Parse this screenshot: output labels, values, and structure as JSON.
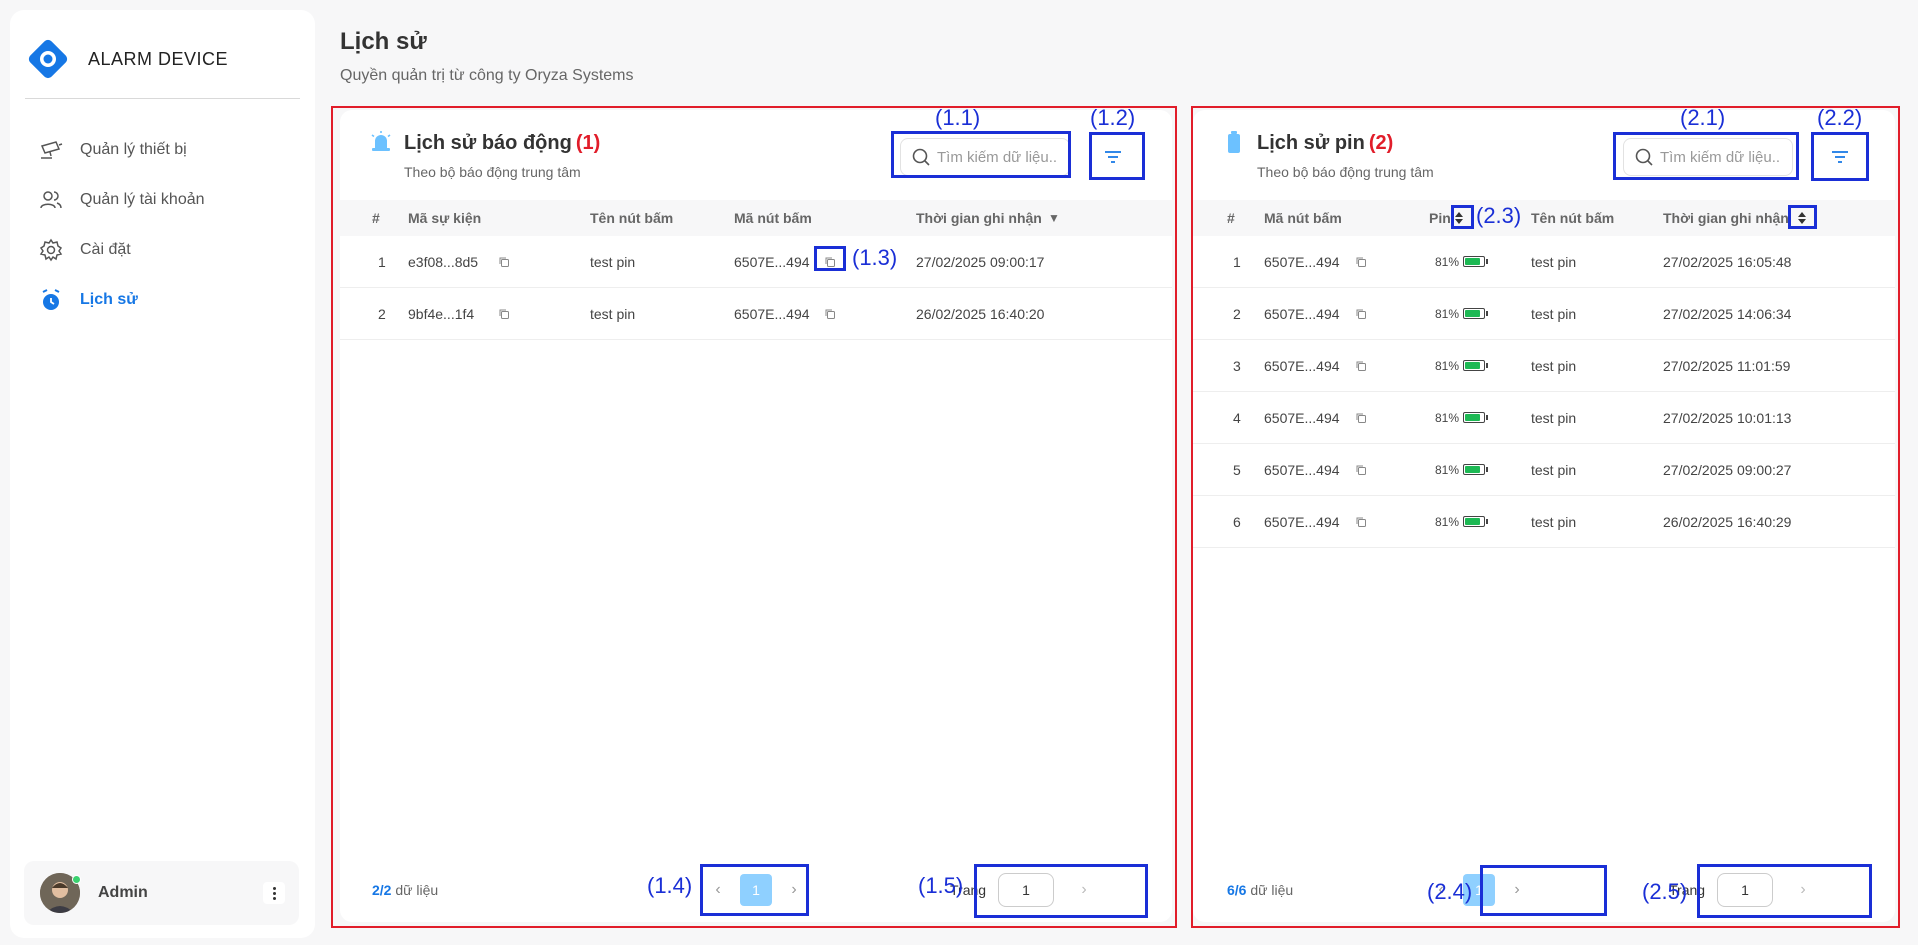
{
  "app": {
    "brand": "ALARM DEVICE"
  },
  "sidebar": {
    "items": [
      {
        "label": "Quản lý thiết bị",
        "icon": "camera-icon"
      },
      {
        "label": "Quản lý tài khoản",
        "icon": "users-icon"
      },
      {
        "label": "Cài đặt",
        "icon": "gear-icon"
      },
      {
        "label": "Lịch sử",
        "icon": "history-icon",
        "active": true
      }
    ],
    "user": {
      "name": "Admin"
    }
  },
  "page": {
    "title": "Lịch sử",
    "subtitle": "Quyền quản trị từ công ty Oryza Systems"
  },
  "alarm_panel": {
    "title": "Lịch sử báo động",
    "marker": "(1)",
    "subtitle": "Theo bộ báo động trung tâm",
    "search_placeholder": "Tìm kiếm dữ liệu...",
    "columns": [
      "#",
      "Mã sự kiện",
      "Tên nút bấm",
      "Mã nút bấm",
      "Thời gian ghi nhận",
      "▼"
    ],
    "rows": [
      {
        "index": "1",
        "event_id": "e3f08...8d5",
        "button_name": "test pin",
        "button_id": "6507E...494",
        "time": "27/02/2025 09:00:17"
      },
      {
        "index": "2",
        "event_id": "9bf4e...1f4",
        "button_name": "test pin",
        "button_id": "6507E...494",
        "time": "26/02/2025 16:40:20"
      }
    ],
    "count_shown": "2",
    "count_total": "/2",
    "count_suffix": "dữ liệu",
    "page": "1",
    "goto_label": "Trang",
    "goto_value": "1",
    "annotations": [
      "(1.1)",
      "(1.2)",
      "(1.3)",
      "(1.4)",
      "(1.5)"
    ]
  },
  "battery_panel": {
    "title": "Lịch sử pin",
    "marker": "(2)",
    "subtitle": "Theo bộ báo động trung tâm",
    "search_placeholder": "Tìm kiếm dữ liệu...",
    "columns": [
      "#",
      "Mã nút bấm",
      "Pin",
      "Tên nút bấm",
      "Thời gian ghi nhận"
    ],
    "rows": [
      {
        "index": "1",
        "button_id": "6507E...494",
        "battery": "81%",
        "battery_level": 0.81,
        "button_name": "test pin",
        "time": "27/02/2025 16:05:48"
      },
      {
        "index": "2",
        "button_id": "6507E...494",
        "battery": "81%",
        "battery_level": 0.81,
        "button_name": "test pin",
        "time": "27/02/2025 14:06:34"
      },
      {
        "index": "3",
        "button_id": "6507E...494",
        "battery": "81%",
        "battery_level": 0.81,
        "button_name": "test pin",
        "time": "27/02/2025 11:01:59"
      },
      {
        "index": "4",
        "button_id": "6507E...494",
        "battery": "81%",
        "battery_level": 0.81,
        "button_name": "test pin",
        "time": "27/02/2025 10:01:13"
      },
      {
        "index": "5",
        "button_id": "6507E...494",
        "battery": "81%",
        "battery_level": 0.81,
        "button_name": "test pin",
        "time": "27/02/2025 09:00:27"
      },
      {
        "index": "6",
        "button_id": "6507E...494",
        "battery": "81%",
        "battery_level": 0.81,
        "button_name": "test pin",
        "time": "26/02/2025 16:40:29"
      }
    ],
    "count_shown": "6",
    "count_total": "/6",
    "count_suffix": "dữ liệu",
    "page": "1",
    "goto_label": "Trang",
    "goto_value": "1",
    "annotations": [
      "(2.1)",
      "(2.2)",
      "(2.3)",
      "(2.4)",
      "(2.5)"
    ]
  },
  "colors": {
    "accent": "#1677e5",
    "annotation_blue": "#1a2fd6",
    "annotation_red": "#e11d2a",
    "battery_green": "#1db954",
    "page_active": "#8fd0ff"
  }
}
